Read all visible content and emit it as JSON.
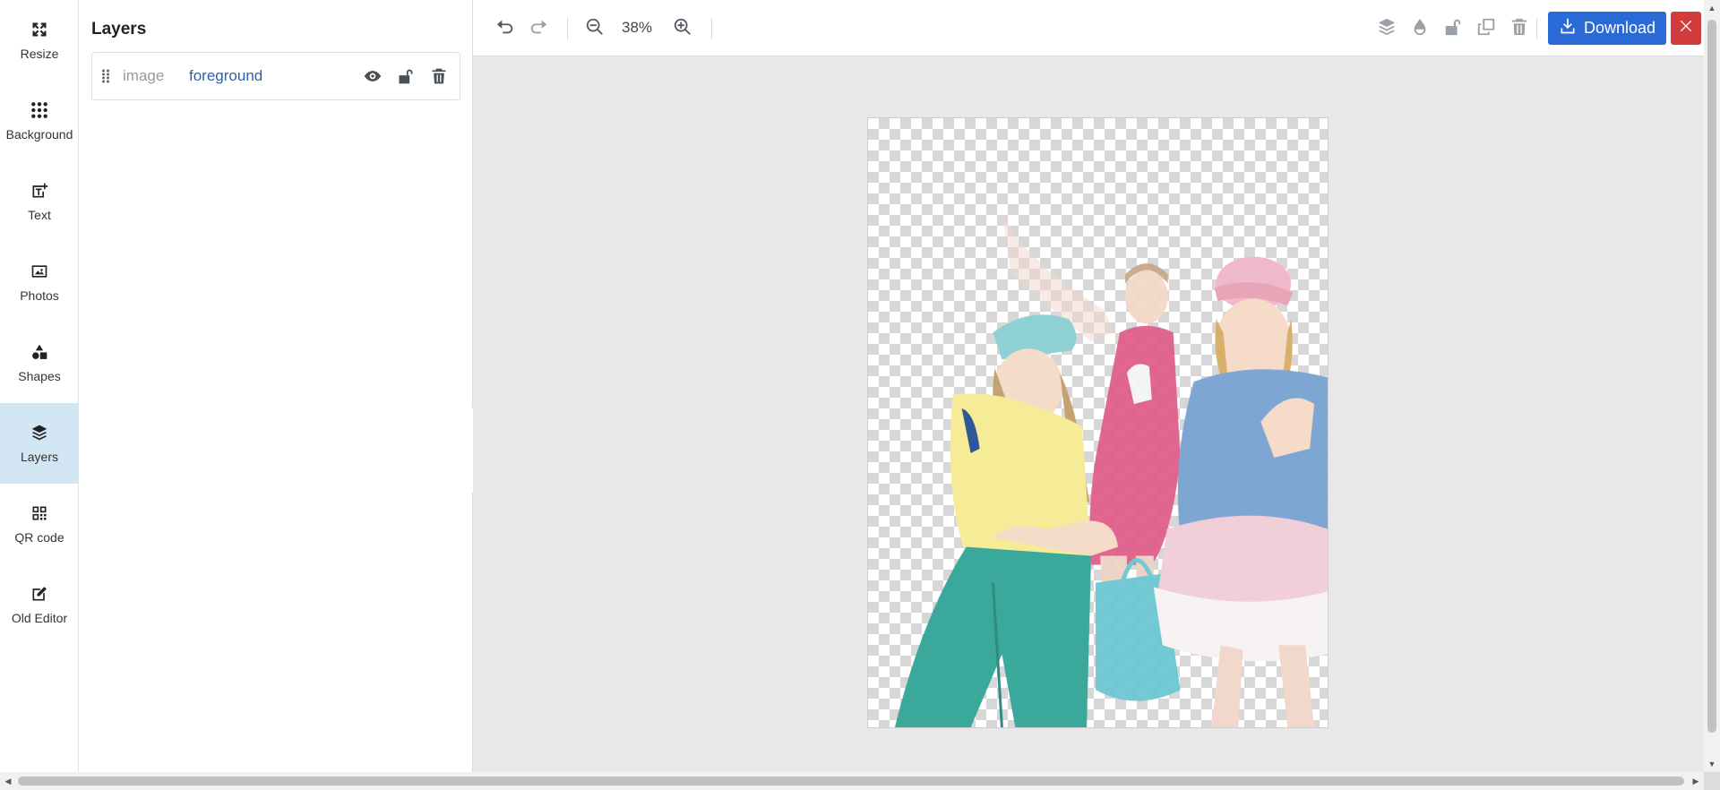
{
  "sidebar": {
    "items": [
      {
        "label": "Resize",
        "icon": "resize-icon",
        "active": false
      },
      {
        "label": "Background",
        "icon": "dots-grid-icon",
        "active": false
      },
      {
        "label": "Text",
        "icon": "text-icon",
        "active": false
      },
      {
        "label": "Photos",
        "icon": "image-icon",
        "active": false
      },
      {
        "label": "Shapes",
        "icon": "shapes-icon",
        "active": false
      },
      {
        "label": "Layers",
        "icon": "layers-icon",
        "active": true
      },
      {
        "label": "QR code",
        "icon": "qr-code-icon",
        "active": false
      },
      {
        "label": "Old Editor",
        "icon": "edit-icon",
        "active": false
      }
    ]
  },
  "panel": {
    "title": "Layers",
    "layers": [
      {
        "type": "image",
        "name": "foreground"
      }
    ]
  },
  "toolbar": {
    "zoom": "38%",
    "download_label": "Download"
  },
  "colors": {
    "accent": "#2a6ad6",
    "close": "#d23c3c",
    "active_rail": "#d3e6f4",
    "layer_name": "#2a5fb3"
  }
}
